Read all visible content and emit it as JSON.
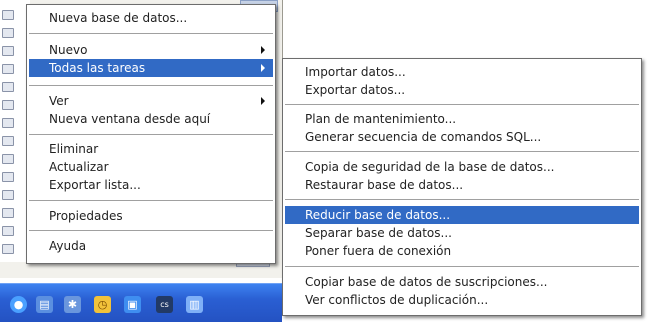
{
  "context_menu": {
    "items": [
      {
        "label": "Nueva base de datos..."
      },
      {
        "label": "Nuevo"
      },
      {
        "label": "Todas las tareas"
      },
      {
        "label": "Ver"
      },
      {
        "label": "Nueva ventana desde aquí"
      },
      {
        "label": "Eliminar"
      },
      {
        "label": "Actualizar"
      },
      {
        "label": "Exportar lista..."
      },
      {
        "label": "Propiedades"
      },
      {
        "label": "Ayuda"
      }
    ],
    "highlighted": "Todas las tareas"
  },
  "submenu": {
    "items": [
      {
        "label": "Importar datos..."
      },
      {
        "label": "Exportar datos..."
      },
      {
        "label": "Plan de mantenimiento..."
      },
      {
        "label": "Generar secuencia de comandos SQL..."
      },
      {
        "label": "Copia de seguridad de la base de datos..."
      },
      {
        "label": "Restaurar base de datos..."
      },
      {
        "label": "Reducir base de datos..."
      },
      {
        "label": "Separar base de datos..."
      },
      {
        "label": "Poner fuera de conexión"
      },
      {
        "label": "Copiar base de datos de suscripciones..."
      },
      {
        "label": "Ver conflictos de duplicación..."
      }
    ],
    "highlighted": "Reducir base de datos..."
  },
  "colors": {
    "highlight": "#316ac5",
    "taskbar": "#2a5fd3"
  },
  "taskbar": {
    "icons": [
      "app-icon",
      "database-icon",
      "tools-icon",
      "clock-icon",
      "folder-icon",
      "console-icon",
      "document-icon"
    ]
  }
}
